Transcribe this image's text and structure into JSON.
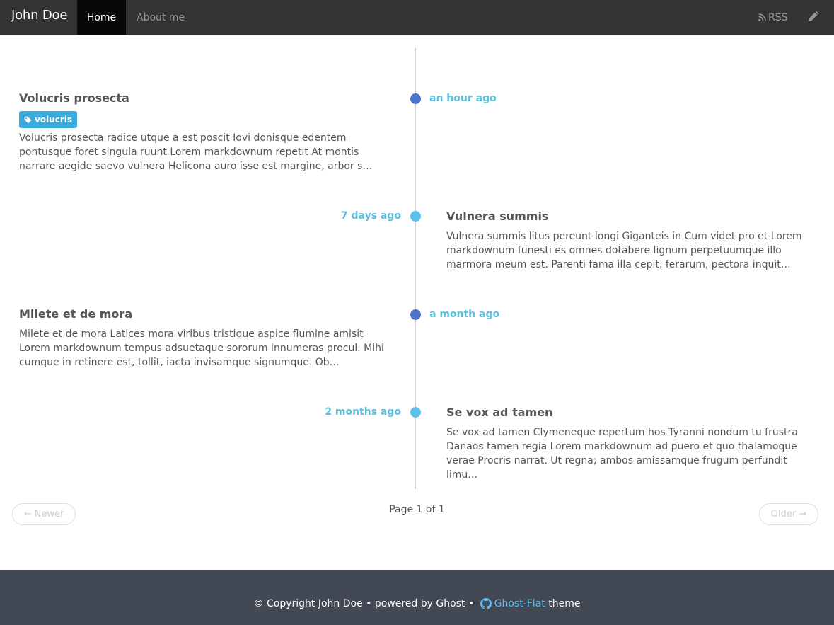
{
  "nav": {
    "brand": "John Doe",
    "home": "Home",
    "about": "About me",
    "rss": "RSS",
    "rss_icon": "rss-icon",
    "edit_icon": "pencil-icon"
  },
  "posts": [
    {
      "title": "Volucris prosecta",
      "time": "an hour ago",
      "tag": "volucris",
      "tag_icon": "tag-icon",
      "excerpt": "Volucris prosecta radice utque a est poscit Iovi donisque edentem pontusque foret singula ruunt Lorem markdownum repetit At montis narrare aegide saevo vulnera Helicona auro isse est margine, arbor s…"
    },
    {
      "title": "Vulnera summis",
      "time": "7 days ago",
      "excerpt": "Vulnera summis litus pereunt longi Giganteis in Cum videt pro et Lorem markdownum funesti es omnes dotabere lignum perpetuumque illo marmora meum est. Parenti fama illa cepit, ferarum, pectora inquit…"
    },
    {
      "title": "Milete et de mora",
      "time": "a month ago",
      "excerpt": "Milete et de mora Latices mora viribus tristique aspice flumine amisit Lorem markdownum tempus adsuetaque sororum innumeras procul. Mihi cumque in retinere est, tollit, iacta invisamque signumque. Ob…"
    },
    {
      "title": "Se vox ad tamen",
      "time": "2 months ago",
      "excerpt": "Se vox ad tamen Clymeneque repertum hos Tyranni nondum tu frustra Danaos tamen regia Lorem markdownum ad puero et quo thalamoque verae Procris narrat. Ut regna; ambos amissamque frugum perfundit limu…"
    }
  ],
  "pagination": {
    "newer": "← Newer",
    "page": "Page 1 of 1",
    "older": "Older →"
  },
  "footer": {
    "copyright": "© Copyright John Doe • powered by Ghost • ",
    "theme_link": "Ghost-Flat",
    "theme_suffix": " theme",
    "github_icon": "github-icon"
  },
  "colors": {
    "navbar": "#333333",
    "accent": "#5bc0de",
    "dot_dark": "#4b73c9",
    "dot_light": "#5bc0eb",
    "tag": "#39aadc",
    "footer": "#434855"
  }
}
